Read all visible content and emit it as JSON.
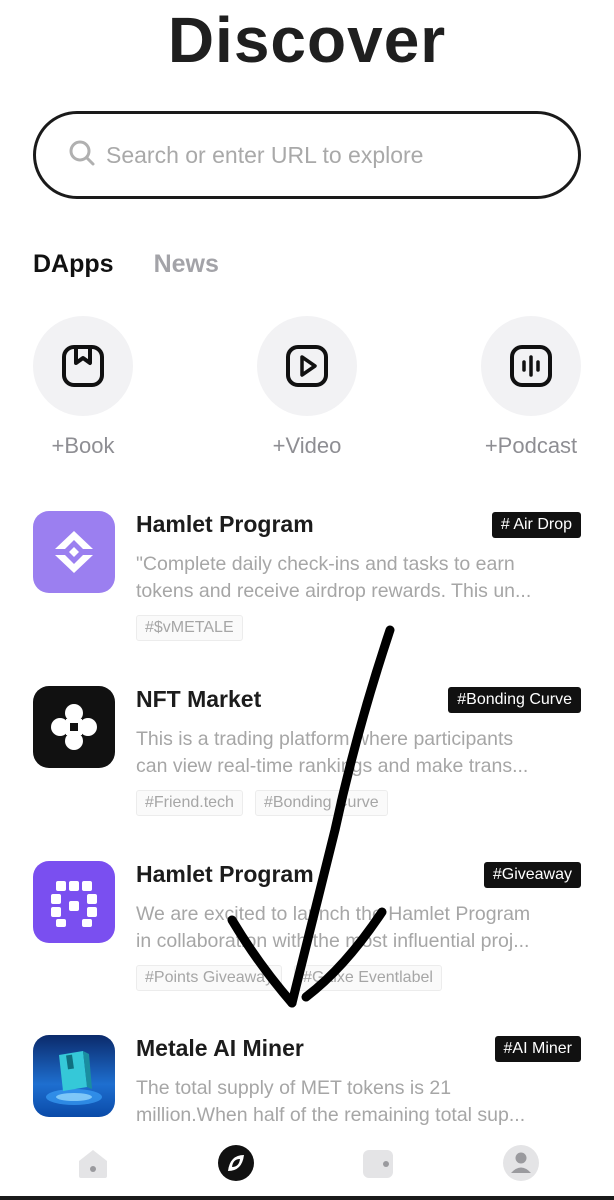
{
  "header": {
    "title": "Discover"
  },
  "search": {
    "placeholder": "Search or enter URL to explore"
  },
  "tabs": [
    {
      "label": "DApps",
      "active": true
    },
    {
      "label": "News",
      "active": false
    }
  ],
  "quick_actions": [
    {
      "label": "+Book",
      "icon": "bookmark-icon"
    },
    {
      "label": "+Video",
      "icon": "play-icon"
    },
    {
      "label": "+Podcast",
      "icon": "audio-wave-icon"
    }
  ],
  "dapps": [
    {
      "name": "Hamlet Program",
      "badge": "# Air Drop",
      "desc_line1": "\"Complete daily check-ins and tasks to earn",
      "desc_line2": "tokens and receive airdrop rewards. This un...",
      "tags": [
        "#$vMETALE"
      ],
      "icon": "hamlet-logo-icon",
      "color": "#9b7ff0"
    },
    {
      "name": "NFT Market",
      "badge": "#Bonding Curve",
      "desc_line1": "This is a trading platform where participants",
      "desc_line2": "can view real-time rankings and make trans...",
      "tags": [
        "#Friend.tech",
        "#Bonding Curve"
      ],
      "icon": "nft-market-logo-icon",
      "color": "#111111"
    },
    {
      "name": "Hamlet Program",
      "badge": "#Giveaway",
      "desc_line1": "We are excited to launch the Hamlet Program",
      "desc_line2": "in collaboration with the most influential proj...",
      "tags": [
        "#Points Giveaway",
        "#Galxe Eventlabel"
      ],
      "icon": "hamlet-grid-logo-icon",
      "color": "#7a4ff0"
    },
    {
      "name": "Metale AI Miner",
      "badge": "#AI Miner",
      "desc_line1": "The total supply of MET tokens is 21",
      "desc_line2": "million.When half of the remaining total sup...",
      "tags": [],
      "icon": "ai-miner-logo-icon",
      "color": "#1e6fd0"
    }
  ],
  "bottom_nav": [
    {
      "name": "home",
      "icon": "home-icon",
      "active": false
    },
    {
      "name": "discover",
      "icon": "discover-icon",
      "active": true
    },
    {
      "name": "wallet",
      "icon": "wallet-icon",
      "active": false
    },
    {
      "name": "profile",
      "icon": "profile-icon",
      "active": false
    }
  ]
}
